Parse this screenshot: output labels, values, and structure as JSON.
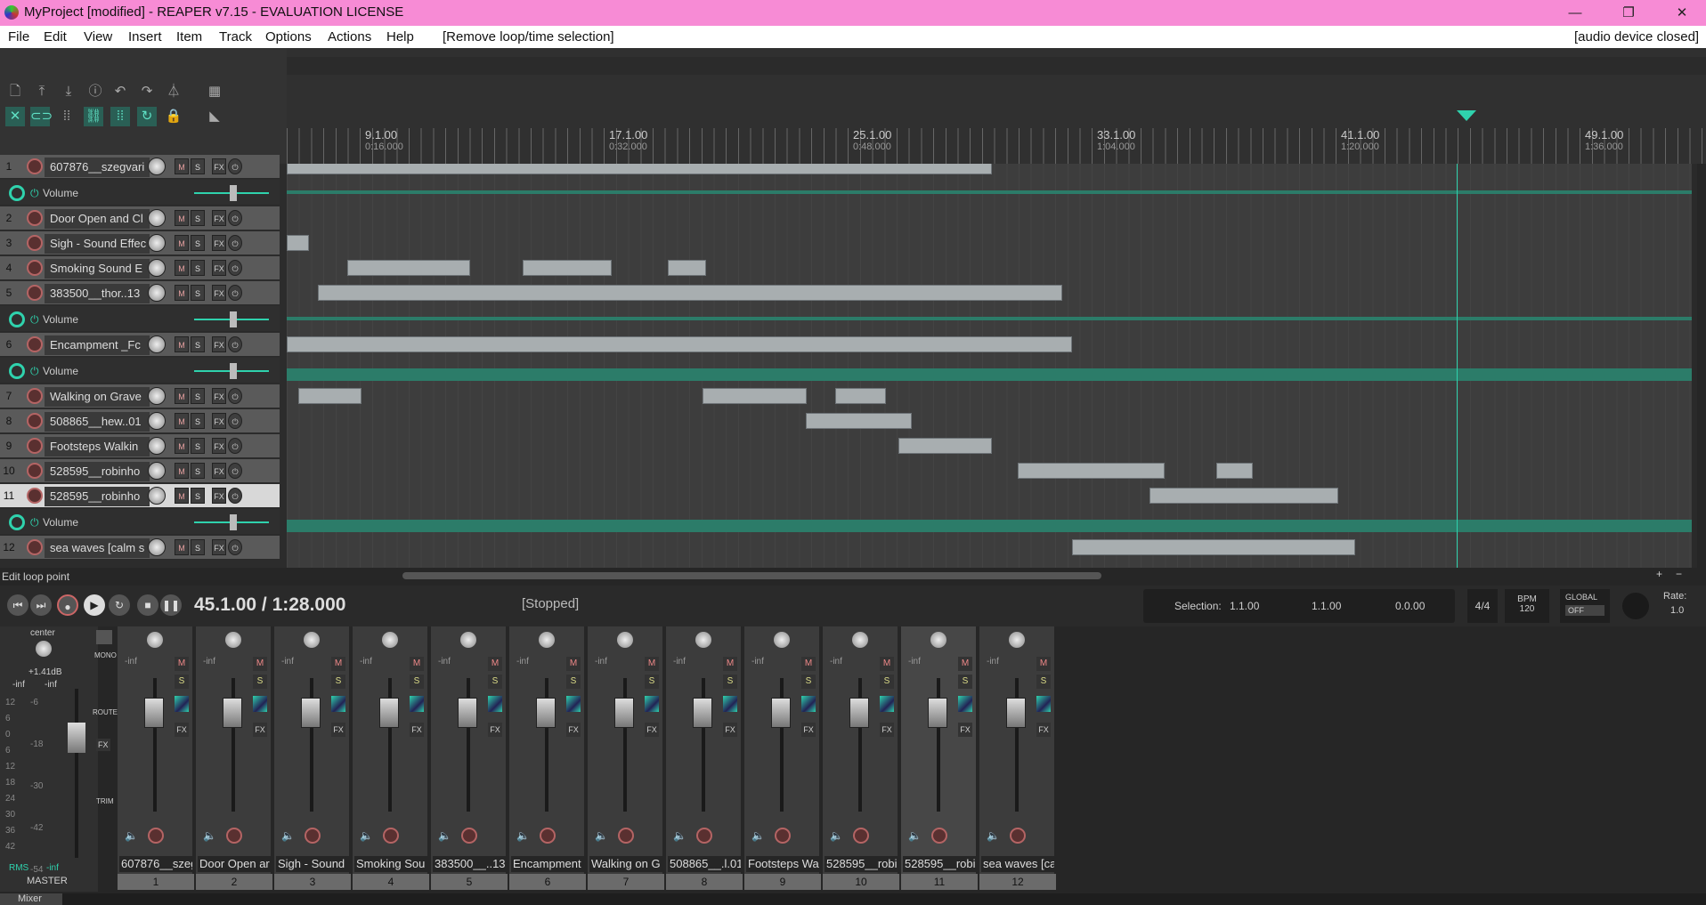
{
  "window": {
    "title": "MyProject [modified] - REAPER v7.15 - EVALUATION LICENSE",
    "min": "—",
    "max": "❐",
    "close": "✕"
  },
  "menu": {
    "items": [
      "File",
      "Edit",
      "View",
      "Insert",
      "Item",
      "Track",
      "Options",
      "Actions",
      "Help"
    ],
    "action_hint": "[Remove loop/time selection]",
    "device_status": "[audio device closed]"
  },
  "ruler": {
    "marks": [
      {
        "bar": "9.1.00",
        "time": "0:16.000"
      },
      {
        "bar": "17.1.00",
        "time": "0:32.000"
      },
      {
        "bar": "25.1.00",
        "time": "0:48.000"
      },
      {
        "bar": "33.1.00",
        "time": "1:04.000"
      },
      {
        "bar": "41.1.00",
        "time": "1:20.000"
      },
      {
        "bar": "49.1.00",
        "time": "1:36.000"
      }
    ]
  },
  "tracks": [
    {
      "num": "1",
      "name": "607876__szegvari",
      "env": "Volume"
    },
    {
      "num": "2",
      "name": "Door Open and Cl"
    },
    {
      "num": "3",
      "name": "Sigh - Sound Effec"
    },
    {
      "num": "4",
      "name": "Smoking Sound E"
    },
    {
      "num": "5",
      "name": "383500__thor..13",
      "env": "Volume"
    },
    {
      "num": "6",
      "name": "Encampment _Fc",
      "env": "Volume"
    },
    {
      "num": "7",
      "name": "Walking on Grave"
    },
    {
      "num": "8",
      "name": "508865__hew..01"
    },
    {
      "num": "9",
      "name": "Footsteps Walkin"
    },
    {
      "num": "10",
      "name": "528595__robinho"
    },
    {
      "num": "11",
      "name": "528595__robinho",
      "env": "Volume"
    },
    {
      "num": "12",
      "name": "sea waves [calm s"
    }
  ],
  "track_buttons": {
    "mute": "M",
    "solo": "S",
    "fx": "FX"
  },
  "status": {
    "hint": "Edit loop point"
  },
  "transport": {
    "position": "45.1.00 / 1:28.000",
    "state": "[Stopped]",
    "selection_label": "Selection:",
    "sel_start": "1.1.00",
    "sel_end": "1.1.00",
    "sel_len": "0.0.00",
    "timesig": "4/4",
    "bpm_label": "BPM",
    "bpm": "120",
    "global_label": "GLOBAL",
    "global_state": "OFF",
    "rate_label": "Rate:",
    "rate": "1.0"
  },
  "master": {
    "pan": "center",
    "peak": "+1.41dB",
    "inf_l": "-inf",
    "inf_r": "-inf",
    "rms": "RMS",
    "rms_val": "-inf",
    "label": "MASTER",
    "mono": "MONO",
    "route": "ROUTE",
    "trim": "TRIM",
    "fx": "FX"
  },
  "meter_scale": [
    "12",
    "6",
    "0",
    "6",
    "12",
    "18",
    "24",
    "30",
    "36",
    "42"
  ],
  "meter_scale2": [
    "-6",
    "-18",
    "-30",
    "-42",
    "-54"
  ],
  "strips": [
    {
      "num": "1",
      "name": "607876__szeg"
    },
    {
      "num": "2",
      "name": "Door Open ar"
    },
    {
      "num": "3",
      "name": "Sigh - Sound"
    },
    {
      "num": "4",
      "name": "Smoking Sou"
    },
    {
      "num": "5",
      "name": "383500__..13"
    },
    {
      "num": "6",
      "name": "Encampment"
    },
    {
      "num": "7",
      "name": "Walking on G"
    },
    {
      "num": "8",
      "name": "508865__.l.01"
    },
    {
      "num": "9",
      "name": "Footsteps Wa"
    },
    {
      "num": "10",
      "name": "528595__robi"
    },
    {
      "num": "11",
      "name": "528595__robi"
    },
    {
      "num": "12",
      "name": "sea waves [ca"
    }
  ],
  "strip_common": {
    "inf": "-inf",
    "m": "M",
    "s": "S",
    "fx": "FX"
  },
  "mixer_tab": "Mixer",
  "colors": {
    "title_bg": "#f78bd5",
    "env": "#2fd2ad",
    "item": "#a8aeb0",
    "rec": "#b46464"
  }
}
